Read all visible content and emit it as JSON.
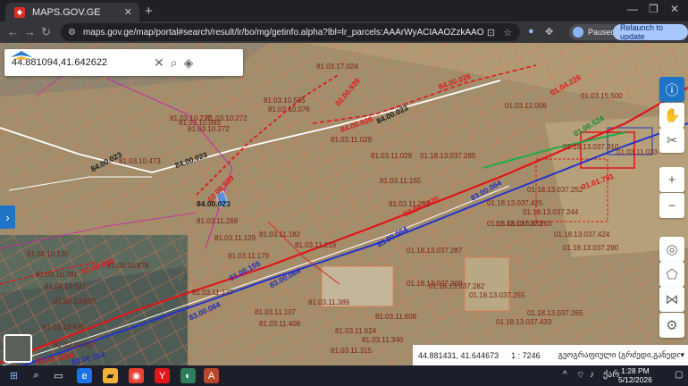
{
  "browser": {
    "tab_title": "MAPS.GOV.GE",
    "tab_close": "✕",
    "new_tab": "+",
    "url": "maps.gov.ge/map/portal#search/result/lr/bo/mg/getinfo.alpha?lbl=lr_parcels:AAArWyACIAAOZzkAAO",
    "paused_label": "Paused",
    "relaunch_label": "Relaunch to update"
  },
  "map": {
    "search_value": "44.881094,41.642622",
    "parcel_labels": [
      "81.03.17.024",
      "81.03.10.272",
      "81.03.10.535",
      "81.03.10.076",
      "81.03.10.277",
      "81.03.10.272",
      "81.03.10.083",
      "81.03.10.473",
      "81.03.11.029",
      "81.03.11.029",
      "81.03.11.155",
      "81.03.11.202",
      "81.03.11.269",
      "81.03.11.179",
      "81.03.11.218",
      "81.03.11.182",
      "81.03.11.129",
      "81.03.10.878",
      "81.03.10.120",
      "81.03.10.781",
      "81.03.10.521",
      "81.03.10.570",
      "81.03.11.177",
      "81.03.11.107",
      "81.03.11.389",
      "81.03.11.408",
      "81.03.11.608",
      "81.03.11.624",
      "81.03.11.340",
      "81.03.11.315",
      "81.03.10.939",
      "81.03.10.437",
      "01.18.13.037.285",
      "01.18.13.037.425",
      "01.18.13.037.263",
      "01.18.13.037.290",
      "01.18.13.037.287",
      "01.18.13.037.300",
      "01.18.13.037.255",
      "01.18.13.037.265",
      "01.18.13.037.333",
      "01.18.13.037.433",
      "01.18.13.037.244",
      "01.18.13.037.424",
      "01.03.12.006",
      "01.03.15.500",
      "01.18.13.037.310",
      "01.18.13.037.252",
      "01.03.11.033",
      "01.18.13.037.282"
    ],
    "road_labels": [
      "84.00.023",
      "84.00.023",
      "84.00.023",
      "84.00.023"
    ],
    "red_labels": [
      "02.00.939",
      "02.00.939",
      "84.00.026",
      "84.00.026",
      "02.00.059",
      "02.00.1020",
      "02.00.1020",
      "01.04.226",
      "01.01.781"
    ],
    "blue_labels": [
      "83.00.064",
      "83.00.064",
      "83.00.064",
      "83.00.064",
      "83.00.064",
      "81.00.155"
    ],
    "green_labels": [
      "01.00.524"
    ]
  },
  "coordinates": {
    "point": "44.881431, 41.644673",
    "scale": "1 : 7246",
    "projection": "გეოგრაფიული (გრძედი,განედი)"
  },
  "taskbar": {
    "time": "1:28 PM",
    "date": "5/12/2026",
    "lang": "ქარ"
  },
  "colors": {
    "cadastre_line": "#e8754b",
    "red_line": "#e0161a",
    "road_line": "#ffffff",
    "blue_line": "#2233cc",
    "accent": "#1f74c7"
  }
}
